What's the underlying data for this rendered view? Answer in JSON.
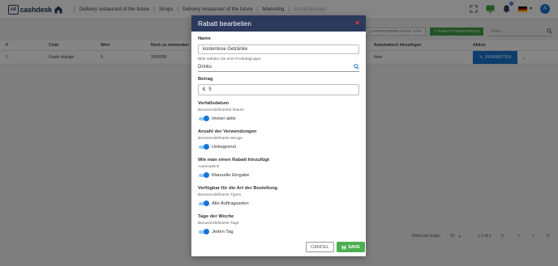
{
  "app": {
    "logo_text": "cashdesk",
    "logo_mark": "cd"
  },
  "breadcrumb": [
    "Delivery restaurant of the future",
    "Shops",
    "Delivery restaurant of the future",
    "Marketing",
    "Ermäßigungen"
  ],
  "topbar": {
    "notification_count": "0",
    "avatar_letter": "A"
  },
  "table": {
    "export_label": "EXPORTIEREN NACH .CSV",
    "add_label": "RABATT HINZUFÜGEN",
    "filter_placeholder": "Filtern",
    "headers": {
      "num": "#",
      "code": "Code",
      "value": "Wert",
      "max": "Noch zu verwenden",
      "auto": "Automatisch hinzufügen",
      "action": "Aktion"
    },
    "row": {
      "num": "1",
      "code": "Gratis drankje",
      "value": "5",
      "max": "2000000",
      "auto": "Nein",
      "edit": "BEARBEITEN"
    },
    "footer": {
      "rows_label": "Rows per page:",
      "rows_value": "10",
      "range": "1-1 of 1"
    }
  },
  "dialog": {
    "title": "Rabatt bearbeiten",
    "name_label": "Name",
    "name_value": "kostenlose Getränke",
    "group_hint": "Bitte wählen Sie eine Produktgruppe",
    "group_value": "Drinks",
    "amount_label": "Betrag",
    "amount_currency": "€",
    "amount_value": "5",
    "expiry_label": "Verfallsdatum",
    "expiry_sub": "Benutzerdefiniertes Datum",
    "expiry_toggle": "Immer aktiv",
    "uses_label": "Anzahl der Verwendungen",
    "uses_sub": "Benutzerdefinierte Menge",
    "uses_toggle": "Unbegrenzt",
    "how_label": "Wie man einen Rabatt hinzufügt",
    "how_sub": "Automatisch",
    "how_toggle": "Manuelle Eingabe",
    "order_label": "Verfügbar für die Art der Bestellung",
    "order_sub": "Benutzerdefinierte Typen",
    "order_toggle": "Alle Auftragsarten",
    "days_label": "Tage der Woche",
    "days_sub": "Benutzerdefinierte Tage",
    "days_toggle": "Jeden Tag",
    "cancel_label": "CANCEL",
    "save_label": "SAVE"
  },
  "colors": {
    "header": "#2b3a5c",
    "primary": "#1976d2",
    "success": "#4caf50",
    "danger": "#e53935"
  }
}
